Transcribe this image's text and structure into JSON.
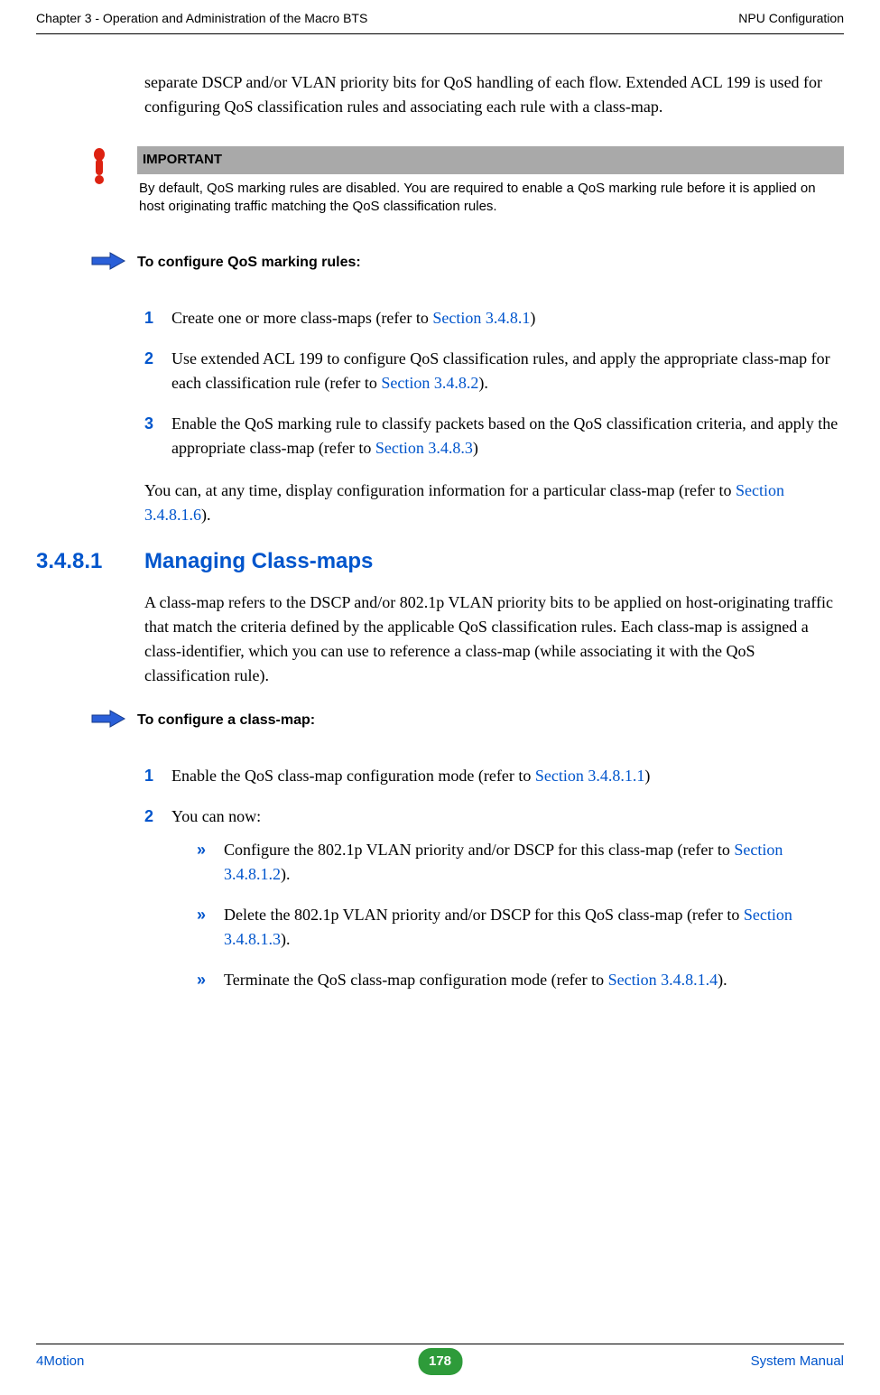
{
  "header": {
    "left": "Chapter 3 - Operation and Administration of the Macro BTS",
    "right": "NPU Configuration"
  },
  "intro": "separate DSCP and/or VLAN priority bits for QoS handling of each flow. Extended ACL 199 is used for configuring QoS classification rules and associating each rule with a class-map.",
  "important": {
    "label": "IMPORTANT",
    "body": "By default, QoS marking rules are disabled. You are required to enable a QoS marking rule before it is applied on host originating traffic matching the QoS classification rules."
  },
  "proc1": {
    "title": "To configure QoS marking rules:",
    "items": [
      {
        "n": "1",
        "pre": "Create one or more class-maps (refer to ",
        "link": "Section 3.4.8.1",
        "post": ")"
      },
      {
        "n": "2",
        "pre": "Use extended ACL 199 to configure QoS classification rules, and apply the appropriate class-map for each classification rule (refer to ",
        "link": "Section 3.4.8.2",
        "post": ")."
      },
      {
        "n": "3",
        "pre": "Enable the QoS marking rule to classify packets based on the QoS classification criteria, and apply the appropriate class-map (refer to ",
        "link": "Section 3.4.8.3",
        "post": ")"
      }
    ]
  },
  "para_after_proc1_pre": "You can, at any time, display configuration information for a particular class-map (refer to ",
  "para_after_proc1_link": "Section 3.4.8.1.6",
  "para_after_proc1_post": ").",
  "section": {
    "num": "3.4.8.1",
    "title": "Managing Class-maps",
    "body": "A class-map refers to the DSCP and/or 802.1p VLAN priority bits to be applied on host-originating traffic that match the criteria defined by the applicable QoS classification rules. Each class-map is assigned a class-identifier, which you can use to reference a class-map (while associating it with the QoS classification rule)."
  },
  "proc2": {
    "title": "To configure a class-map:",
    "items": [
      {
        "n": "1",
        "pre": "Enable the QoS class-map configuration mode (refer to ",
        "link": "Section 3.4.8.1.1",
        "post": ")"
      },
      {
        "n": "2",
        "pre": "You can now:"
      }
    ],
    "sub": [
      {
        "pre": "Configure the 802.1p VLAN priority and/or DSCP for this class-map (refer to ",
        "link": "Section 3.4.8.1.2",
        "post": ")."
      },
      {
        "pre": "Delete the 802.1p VLAN priority and/or DSCP for this QoS class-map (refer to ",
        "link": "Section 3.4.8.1.3",
        "post": ")."
      },
      {
        "pre": "Terminate the QoS class-map configuration mode (refer to ",
        "link": "Section 3.4.8.1.4",
        "post": ")."
      }
    ]
  },
  "footer": {
    "left": "4Motion",
    "page": "178",
    "right": "System Manual"
  },
  "glyphs": {
    "chevron": "»"
  }
}
